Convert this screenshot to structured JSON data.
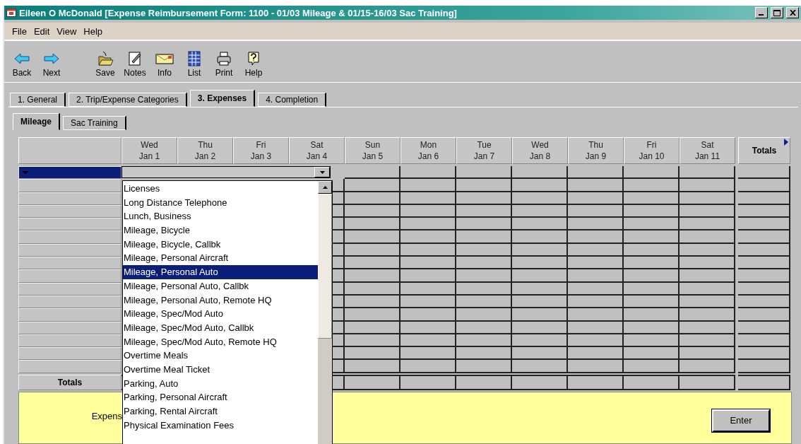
{
  "window": {
    "title": "Eileen O McDonald [Expense Reimbursement Form: 1100 - 01/03 Mileage & 01/15-16/03 Sac Training]"
  },
  "menu": [
    "File",
    "Edit",
    "View",
    "Help"
  ],
  "toolbar_groups": [
    [
      {
        "label": "Back",
        "kind": "back"
      },
      {
        "label": "Next",
        "kind": "next"
      }
    ],
    [
      {
        "label": "Save",
        "kind": "save"
      },
      {
        "label": "Notes",
        "kind": "notes"
      },
      {
        "label": "Info",
        "kind": "info"
      },
      {
        "label": "List",
        "kind": "list"
      },
      {
        "label": "Print",
        "kind": "print"
      },
      {
        "label": "Help",
        "kind": "help"
      }
    ]
  ],
  "tabs": [
    {
      "label": "1. General",
      "selected": false
    },
    {
      "label": "2. Trip/Expense Categories",
      "selected": false
    },
    {
      "label": "3. Expenses",
      "selected": true
    },
    {
      "label": "4. Completion",
      "selected": false
    }
  ],
  "subtabs": [
    {
      "label": "Mileage",
      "selected": true
    },
    {
      "label": "Sac Training",
      "selected": false
    }
  ],
  "grid": {
    "columns": [
      {
        "day": "Wed",
        "date": "Jan 1"
      },
      {
        "day": "Thu",
        "date": "Jan 2"
      },
      {
        "day": "Fri",
        "date": "Jan 3"
      },
      {
        "day": "Sat",
        "date": "Jan 4"
      },
      {
        "day": "Sun",
        "date": "Jan 5"
      },
      {
        "day": "Mon",
        "date": "Jan 6"
      },
      {
        "day": "Tue",
        "date": "Jan 7"
      },
      {
        "day": "Wed",
        "date": "Jan 8"
      },
      {
        "day": "Thu",
        "date": "Jan 9"
      },
      {
        "day": "Fri",
        "date": "Jan 10"
      },
      {
        "day": "Sat",
        "date": "Jan 11"
      }
    ],
    "totals_header": "Totals",
    "rows": [
      {
        "selected": true
      },
      {
        "selected": false
      },
      {
        "selected": false
      },
      {
        "selected": false
      },
      {
        "selected": false
      },
      {
        "selected": false
      },
      {
        "selected": false
      },
      {
        "selected": false
      },
      {
        "selected": false
      },
      {
        "selected": false
      },
      {
        "selected": false
      },
      {
        "selected": false
      },
      {
        "selected": false
      },
      {
        "selected": false
      },
      {
        "selected": false
      },
      {
        "selected": false
      }
    ],
    "totals_row_label": "Totals"
  },
  "dropdown": {
    "items": [
      {
        "label": "Licenses",
        "selected": false
      },
      {
        "label": "Long Distance Telephone",
        "selected": false
      },
      {
        "label": "Lunch, Business",
        "selected": false
      },
      {
        "label": "Mileage, Bicycle",
        "selected": false
      },
      {
        "label": "Mileage, Bicycle, Callbk",
        "selected": false
      },
      {
        "label": "Mileage, Personal Aircraft",
        "selected": false
      },
      {
        "label": "Mileage, Personal Auto",
        "selected": true
      },
      {
        "label": "Mileage, Personal Auto, Callbk",
        "selected": false
      },
      {
        "label": "Mileage, Personal Auto, Remote HQ",
        "selected": false
      },
      {
        "label": "Mileage, Spec/Mod Auto",
        "selected": false
      },
      {
        "label": "Mileage, Spec/Mod Auto, Callbk",
        "selected": false
      },
      {
        "label": "Mileage, Spec/Mod Auto, Remote HQ",
        "selected": false
      },
      {
        "label": "Overtime Meals",
        "selected": false
      },
      {
        "label": "Overtime Meal Ticket",
        "selected": false
      },
      {
        "label": "Parking, Auto",
        "selected": false
      },
      {
        "label": "Parking, Personal Aircraft",
        "selected": false
      },
      {
        "label": "Parking, Rental Aircraft",
        "selected": false
      },
      {
        "label": "Physical Examination Fees",
        "selected": false
      }
    ]
  },
  "panel": {
    "label": "Expens",
    "button": "Enter"
  }
}
